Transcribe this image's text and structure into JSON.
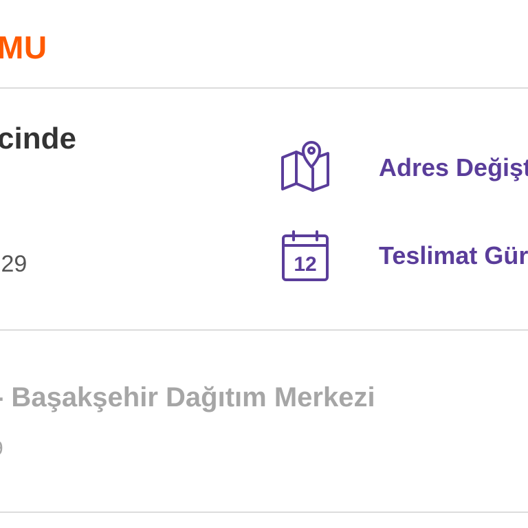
{
  "header": {
    "title": "MU",
    "title_color": "#ff5a00"
  },
  "current_status": {
    "text": "cinde",
    "time": ":29"
  },
  "actions": [
    {
      "label": "Adres Değişt",
      "icon": "map-pin-icon"
    },
    {
      "label": "Teslimat Gür",
      "icon": "calendar-icon",
      "icon_text": "12"
    }
  ],
  "history": {
    "location": "- Başakşehir Dağıtım Merkezi",
    "time": "9"
  },
  "colors": {
    "accent_purple": "#5a3d9a",
    "muted_gray": "#a6a6a6",
    "divider": "#dcdcdc"
  }
}
